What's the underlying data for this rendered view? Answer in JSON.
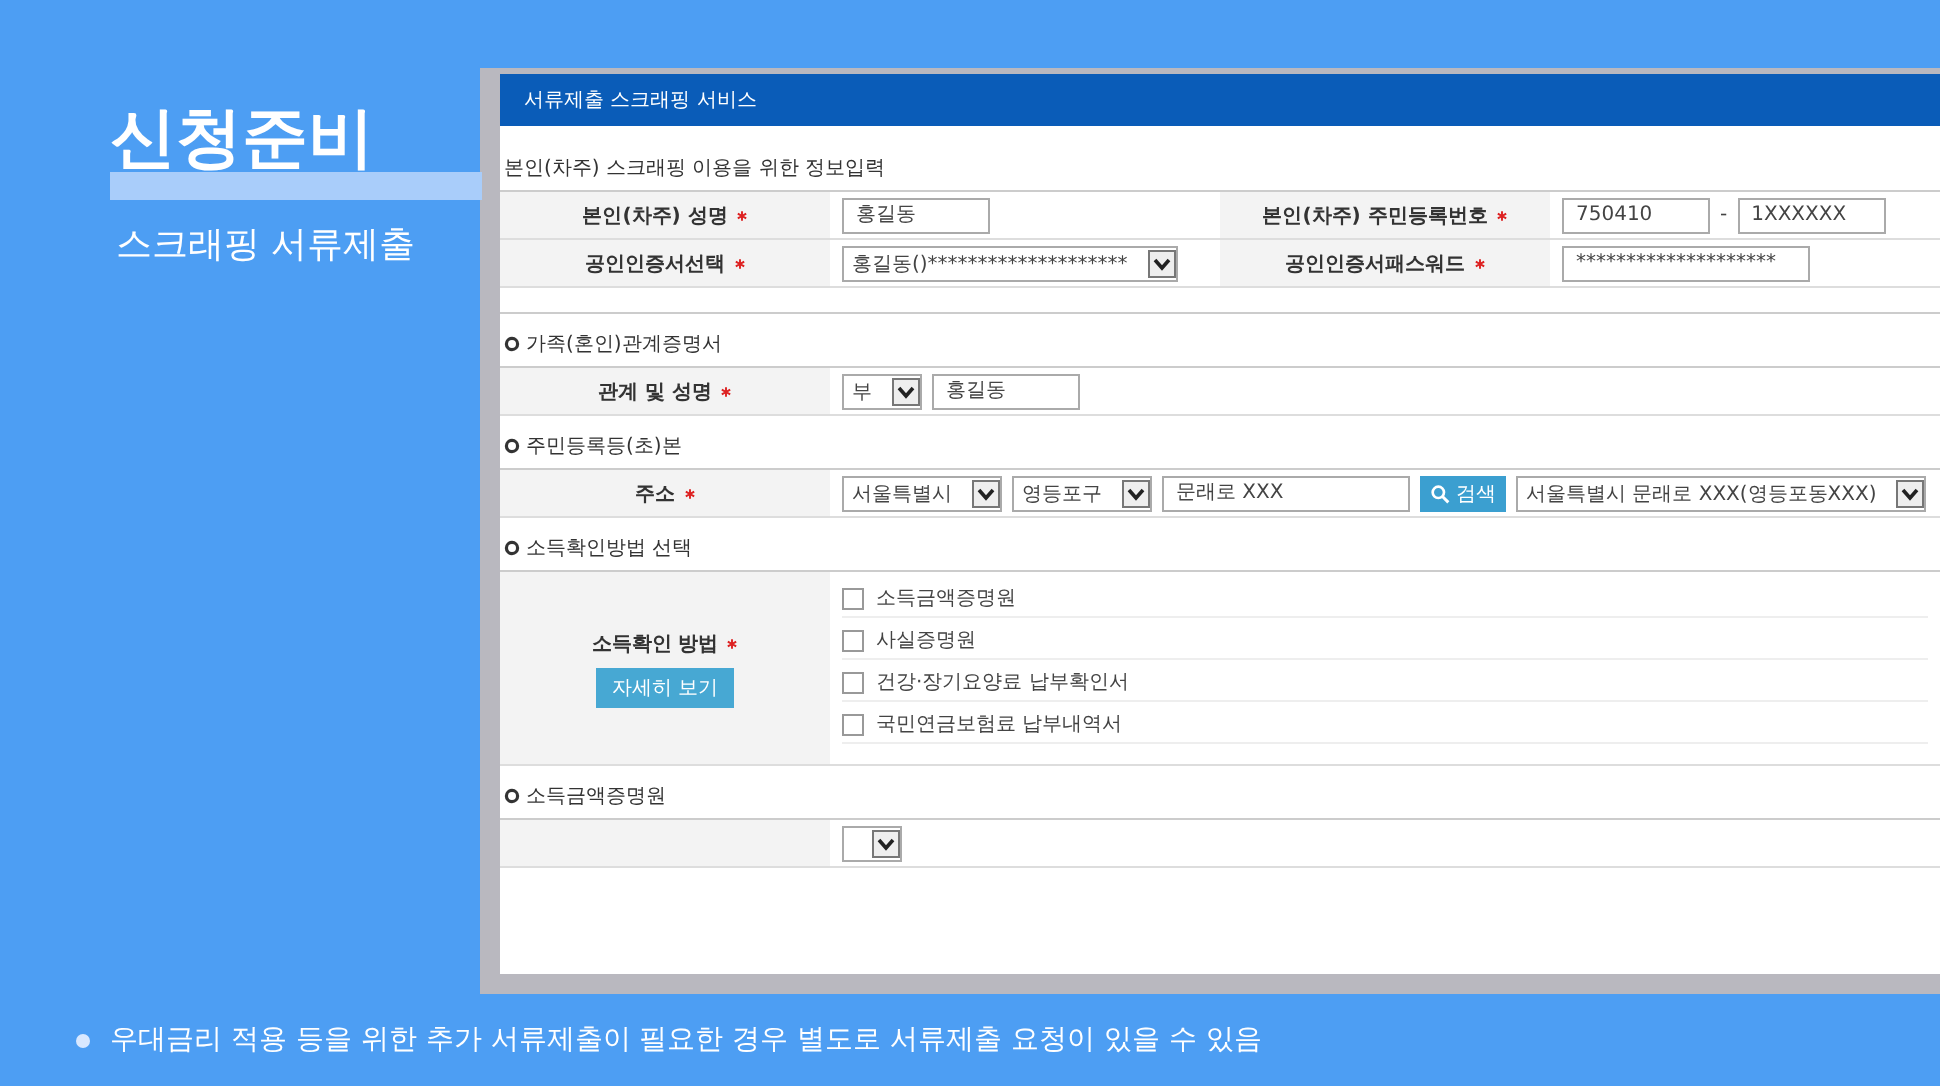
{
  "slide": {
    "title": "신청준비",
    "subtitle": "스크래핑 서류제출",
    "caption": "우대금리 적용 등을 위한 추가 서류제출이 필요한 경우 별도로 서류제출 요청이 있을 수 있음"
  },
  "page": {
    "header": "서류제출 스크래핑 서비스",
    "sections": [
      {
        "title": "본인(차주) 스크래핑 이용을 위한 정보입력",
        "bullet": false,
        "rows": [
          {
            "cells": [
              {
                "label": "본인(차주) 성명",
                "required": true,
                "fields": [
                  {
                    "kind": "text",
                    "value": "홍길동"
                  }
                ]
              },
              {
                "label": "본인(차주) 주민등록번호",
                "required": true,
                "fields": [
                  {
                    "kind": "text",
                    "value": "750410"
                  },
                  {
                    "kind": "sep",
                    "value": "-"
                  },
                  {
                    "kind": "text",
                    "value": "1XXXXXX"
                  }
                ]
              }
            ]
          },
          {
            "cells": [
              {
                "label": "공인인증서선택",
                "required": true,
                "fields": [
                  {
                    "kind": "select",
                    "value": "홍길동()********************"
                  }
                ]
              },
              {
                "label": "공인인증서패스워드",
                "required": true,
                "fields": [
                  {
                    "kind": "wide",
                    "value": "********************"
                  }
                ]
              }
            ]
          }
        ]
      },
      {
        "title": "가족(혼인)관계증명서",
        "bullet": true,
        "rows": [
          {
            "cells": [
              {
                "label": "관계 및 성명",
                "required": true,
                "fields": [
                  {
                    "kind": "select",
                    "value": "부"
                  },
                  {
                    "kind": "text",
                    "value": "홍길동"
                  }
                ]
              }
            ]
          }
        ]
      },
      {
        "title": "주민등록등(초)본",
        "bullet": true,
        "rows": [
          {
            "cells": [
              {
                "label": "주소",
                "required": true,
                "fields": [
                  {
                    "kind": "select",
                    "value": "서울특별시"
                  },
                  {
                    "kind": "select",
                    "value": "영등포구"
                  },
                  {
                    "kind": "wide",
                    "value": "문래로 XXX"
                  },
                  {
                    "kind": "button",
                    "value": "검색"
                  },
                  {
                    "kind": "select",
                    "value": "서울특별시 문래로 XXX(영등포동XXX)"
                  }
                ]
              }
            ]
          }
        ]
      },
      {
        "title": "소득확인방법 선택",
        "bullet": true,
        "rows": [
          {
            "cells": [
              {
                "label": "소득확인 방법",
                "required": true,
                "action": "자세히 보기",
                "fields": [
                  {
                    "kind": "checkbox",
                    "value": "소득금액증명원",
                    "checked": false
                  },
                  {
                    "kind": "checkbox",
                    "value": "사실증명원",
                    "checked": false
                  },
                  {
                    "kind": "checkbox",
                    "value": "건강·장기요양료 납부확인서",
                    "checked": false
                  },
                  {
                    "kind": "checkbox",
                    "value": "국민연금보험료 납부내역서",
                    "checked": false
                  }
                ]
              }
            ]
          }
        ]
      },
      {
        "title": "소득금액증명원",
        "bullet": true,
        "rows": [
          {
            "cells": [
              {
                "fields": [
                  {
                    "kind": "select"
                  }
                ]
              }
            ]
          }
        ]
      }
    ]
  }
}
